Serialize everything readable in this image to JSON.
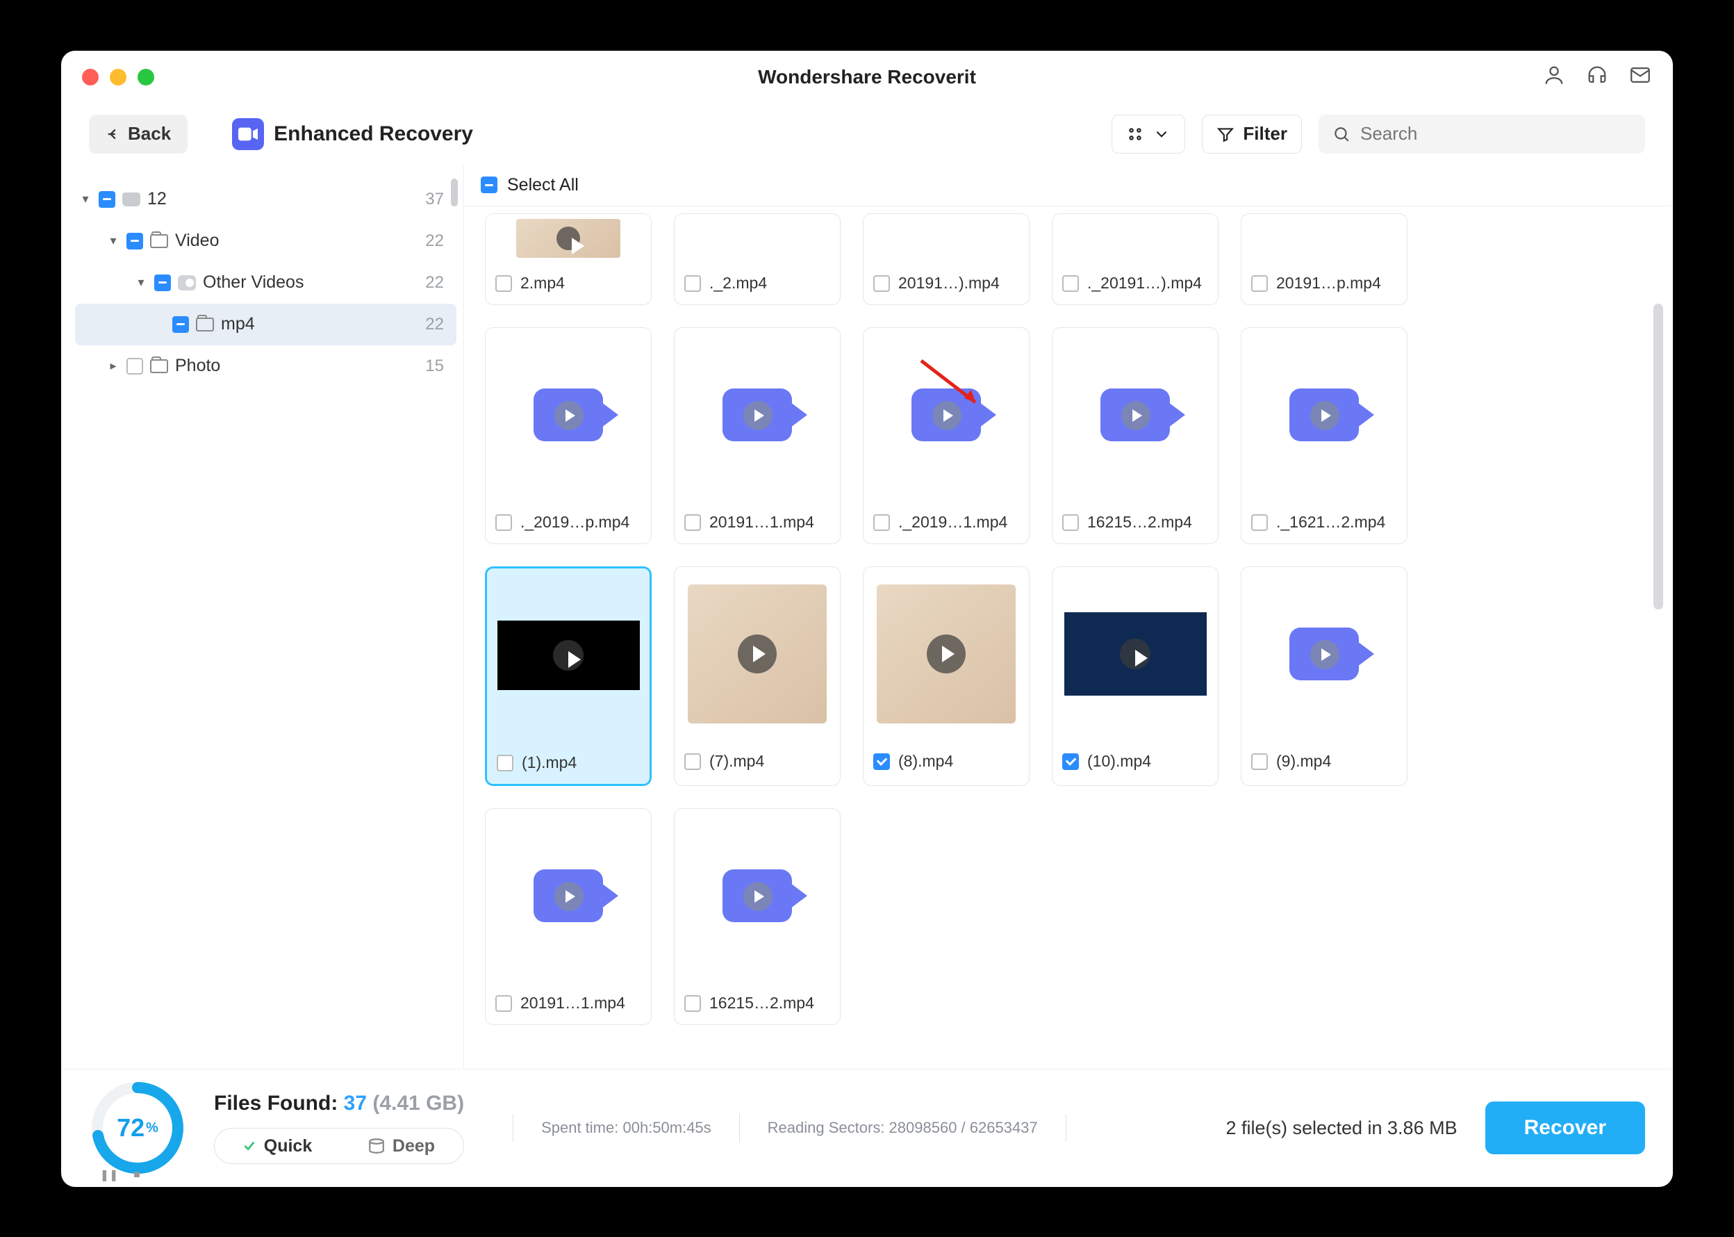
{
  "app_title": "Wondershare Recoverit",
  "toolbar": {
    "back": "Back",
    "brand": "Enhanced Recovery",
    "filter": "Filter",
    "search_placeholder": "Search"
  },
  "tree": {
    "root": {
      "label": "12",
      "count": "37"
    },
    "video": {
      "label": "Video",
      "count": "22"
    },
    "other": {
      "label": "Other Videos",
      "count": "22"
    },
    "mp4": {
      "label": "mp4",
      "count": "22"
    },
    "photo": {
      "label": "Photo",
      "count": "15"
    }
  },
  "select_all": "Select All",
  "files": {
    "r0c0": "2.mp4",
    "r0c1": "._2.mp4",
    "r0c2": "20191…).mp4",
    "r0c3": "._20191…).mp4",
    "r0c4": "20191…p.mp4",
    "r1c0": "._2019…p.mp4",
    "r1c1": "20191…1.mp4",
    "r1c2": "._2019…1.mp4",
    "r1c3": "16215…2.mp4",
    "r1c4": "._1621…2.mp4",
    "r2c0": "(1).mp4",
    "r2c1": "(7).mp4",
    "r2c2": "(8).mp4",
    "r2c3": "(10).mp4",
    "r2c4": "(9).mp4",
    "r3c0": "20191…1.mp4",
    "r3c1": "16215…2.mp4"
  },
  "footer": {
    "progress_pct": "72",
    "pct_sym": "%",
    "found_label": "Files Found: ",
    "found_num": "37",
    "found_size": " (4.41 GB)",
    "mode_quick": "Quick",
    "mode_deep": "Deep",
    "spent": "Spent time: 00h:50m:45s",
    "sectors": "Reading Sectors: 28098560 / 62653437",
    "sel_info": "2 file(s) selected in 3.86 MB",
    "recover": "Recover"
  }
}
